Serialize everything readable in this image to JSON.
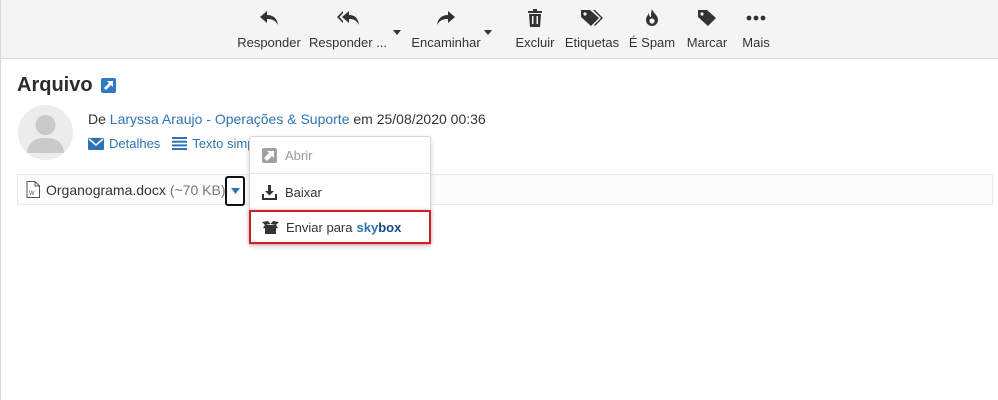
{
  "toolbar": {
    "buttons": [
      {
        "label": "Responder",
        "icon": "reply-icon"
      },
      {
        "label": "Responder ...",
        "icon": "reply-all-icon"
      },
      {
        "label": "Encaminhar",
        "icon": "forward-icon"
      },
      {
        "label": "Excluir",
        "icon": "trash-icon"
      },
      {
        "label": "Etiquetas",
        "icon": "tags-icon"
      },
      {
        "label": "É Spam",
        "icon": "spam-fire-icon"
      },
      {
        "label": "Marcar",
        "icon": "tag-icon"
      },
      {
        "label": "Mais",
        "icon": "ellipsis-icon"
      }
    ]
  },
  "message": {
    "title": "Arquivo",
    "from_prefix": "De",
    "sender": "Laryssa Araujo - Operações & Suporte",
    "date_prefix": "em",
    "date": "25/08/2020 00:36",
    "details_label": "Detalhes",
    "plain_text_label": "Texto simp"
  },
  "attachment": {
    "name": "Organograma.docx",
    "size": "(~70 KB)"
  },
  "menu": {
    "open_label": "Abrir",
    "download_label": "Baixar",
    "send_label_prefix": "Enviar para",
    "send_brand_sky": "sky",
    "send_brand_box": "box"
  },
  "colors": {
    "accent": "#2e74b5",
    "highlight_border": "#cc1f1f",
    "toolbar_bg": "#f4f4f4"
  }
}
